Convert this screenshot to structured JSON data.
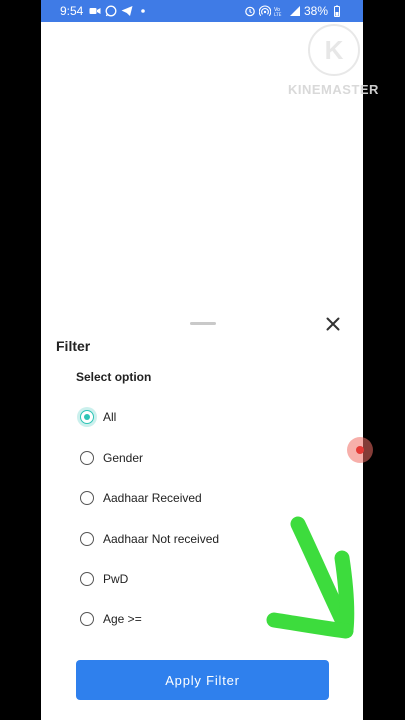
{
  "status_bar": {
    "time": "9:54",
    "battery": "38%",
    "background_color": "#3f7be6",
    "left_icons": [
      "video-icon",
      "whatsapp-icon",
      "telegram-icon",
      "dot-icon"
    ],
    "right_icons": [
      "alarm-icon",
      "hotspot-icon",
      "volte-icon",
      "signal-icon",
      "battery-icon"
    ]
  },
  "watermark": {
    "logo_letter": "K",
    "text": "KINEMASTER"
  },
  "filter_sheet": {
    "title": "Filter",
    "section_label": "Select option",
    "options": [
      {
        "label": "All",
        "selected": true
      },
      {
        "label": "Gender",
        "selected": false
      },
      {
        "label": "Aadhaar Received",
        "selected": false
      },
      {
        "label": "Aadhaar Not received",
        "selected": false
      },
      {
        "label": "PwD",
        "selected": false
      },
      {
        "label": "Age >=",
        "selected": false
      }
    ],
    "apply_button": "Apply Filter",
    "accent_color": "#2ec4b6",
    "button_color": "#2f80ed"
  },
  "annotation": {
    "arrow_color": "#3ddc3d"
  }
}
